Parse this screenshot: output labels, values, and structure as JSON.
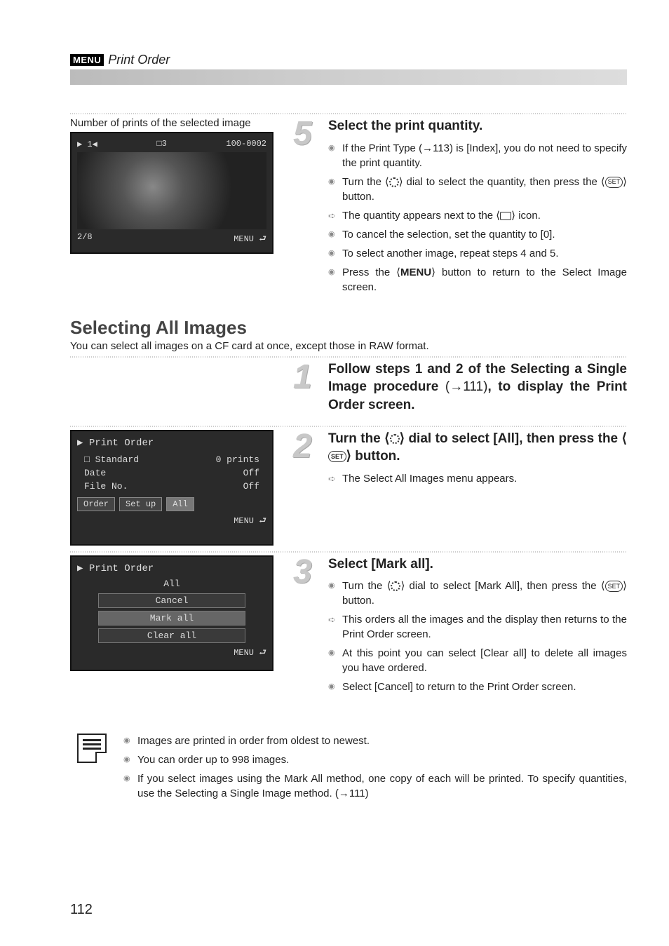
{
  "header": {
    "menu_badge": "MENU",
    "title": "Print Order"
  },
  "step5": {
    "caption": "Number of prints of the selected image",
    "cam": {
      "top_left": "▶ 1◀",
      "top_mid": "□3",
      "top_right": "100-0002",
      "bottom_left": "2/8",
      "bottom_right": "MENU ⮐"
    },
    "num": "5",
    "heading": "Select the print quantity.",
    "b1a": "If the Print Type (→113) is [Index], you do not need to specify the print quantity.",
    "b2a": "Turn the ⟨",
    "b2b": "⟩ dial to select the quantity, then press the ⟨",
    "b2c": "⟩ button.",
    "set": "SET",
    "b3a": "The quantity appears next to the ⟨",
    "b3b": "⟩ icon.",
    "b4": "To cancel the selection, set the quantity to [0].",
    "b5": "To select another image, repeat steps 4 and 5.",
    "b6a": "Press the ⟨",
    "b6b": "MENU",
    "b6c": "⟩ button to return to the Select Image screen."
  },
  "selecting_all": {
    "heading": "Selecting All Images",
    "sub": "You can select all images on a CF card at once, except those in RAW format."
  },
  "step1": {
    "num": "1",
    "heading_a": "Follow steps 1 and 2 of the Selecting a Single Image procedure ",
    "heading_ref": "(→111)",
    "heading_b": ", to display the Print Order screen."
  },
  "step2": {
    "num": "2",
    "cam": {
      "title": "▶ Print Order",
      "l1a": "□ Standard",
      "l1b": "0 prints",
      "l2a": "Date",
      "l2b": "Off",
      "l3a": "File No.",
      "l3b": "Off",
      "t1": "Order",
      "t2": "Set up",
      "t3": "All",
      "footer": "MENU ⮐"
    },
    "heading_a": "Turn the ⟨",
    "heading_b": "⟩ dial to select [All], then press the ⟨",
    "heading_c": "⟩ button.",
    "set": "SET",
    "b1": "The Select All Images menu appears."
  },
  "step3": {
    "num": "3",
    "cam": {
      "title": "▶ Print Order",
      "head": "All",
      "i1": "Cancel",
      "i2": "Mark all",
      "i3": "Clear all",
      "footer": "MENU ⮐"
    },
    "heading": "Select [Mark all].",
    "b1a": "Turn the ⟨",
    "b1b": "⟩ dial to select [Mark All], then press the ⟨",
    "b1c": "⟩ button.",
    "set": "SET",
    "b2": "This orders all the images and the display then returns to the Print Order screen.",
    "b3": "At this point you can select [Clear all] to delete all images you have ordered.",
    "b4": "Select [Cancel] to return to the Print Order screen."
  },
  "notes": {
    "n1": "Images are printed in order from oldest to newest.",
    "n2": "You can order up to 998 images.",
    "n3": "If you select images using the Mark All method, one copy of each will be printed. To specify quantities, use the Selecting a Single Image method. (→111)"
  },
  "page_number": "112"
}
